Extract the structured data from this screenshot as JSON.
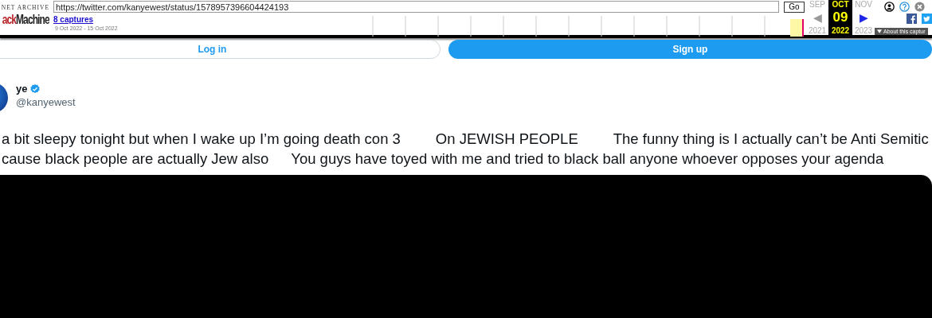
{
  "wayback": {
    "logo_top": "NET ARCHIVE",
    "logo_red": "ack",
    "logo_dark": "Machine",
    "url": "https://twitter.com/kanyewest/status/1578957396604424193",
    "go": "Go",
    "captures": "8 captures",
    "range": "9 Oct 2022 - 15 Oct 2022",
    "months": [
      {
        "month": "SEP",
        "year": "2021",
        "arrow": "◀",
        "selected": false
      },
      {
        "month": "OCT",
        "day": "09",
        "year": "2022",
        "selected": true
      },
      {
        "month": "NOV",
        "year": "2023",
        "arrow": "▶",
        "selected": false
      }
    ],
    "about": "About this captur"
  },
  "auth": {
    "login": "Log in",
    "signup": "Sign up"
  },
  "tweet": {
    "name": "ye",
    "verified": true,
    "handle": "@kanyewest",
    "lines": [
      [
        "a bit sleepy tonight but when I wake up I’m going death con 3",
        "On JEWISH PEOPLE",
        "The funny thing is I actually can’t be Anti Semitic"
      ],
      [
        "cause black people are actually Jew also",
        "You guys have toyed with me and tried to black ball anyone whoever opposes your agenda"
      ]
    ],
    "media": {
      "kind": "video"
    }
  }
}
